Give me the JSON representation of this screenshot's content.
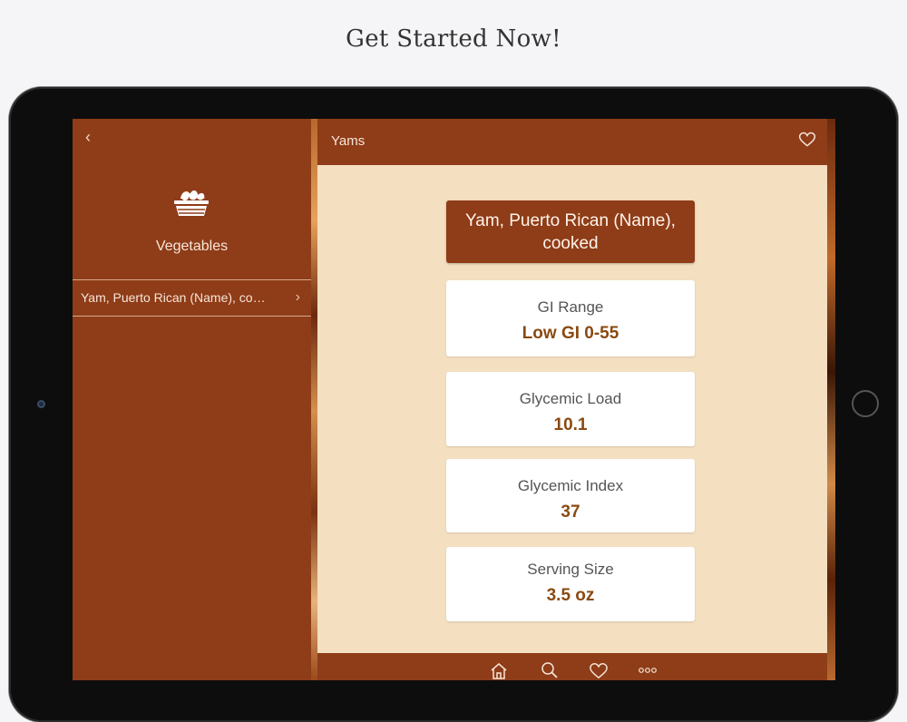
{
  "headline": "Get Started Now!",
  "sidebar": {
    "back_icon": "chevron-left-icon",
    "category_icon": "basket-icon",
    "category_label": "Vegetables",
    "items": [
      {
        "label": "Yam, Puerto Rican (Name), co…"
      }
    ]
  },
  "detail": {
    "title": "Yams",
    "favorite_icon": "heart-outline-icon",
    "food_name": "Yam, Puerto Rican (Name), cooked",
    "cards": [
      {
        "label": "GI Range",
        "value": "Low GI 0-55"
      },
      {
        "label": "Glycemic Load",
        "value": "10.1"
      },
      {
        "label": "Glycemic Index",
        "value": "37"
      },
      {
        "label": "Serving Size",
        "value": "3.5 oz"
      }
    ]
  },
  "tabbar": {
    "tabs": [
      "home-icon",
      "search-icon",
      "heart-icon",
      "more-icon"
    ]
  },
  "colors": {
    "brand_brown": "#8f3c18",
    "content_bg": "#f4dfc1",
    "value_text": "#8a4a12"
  }
}
